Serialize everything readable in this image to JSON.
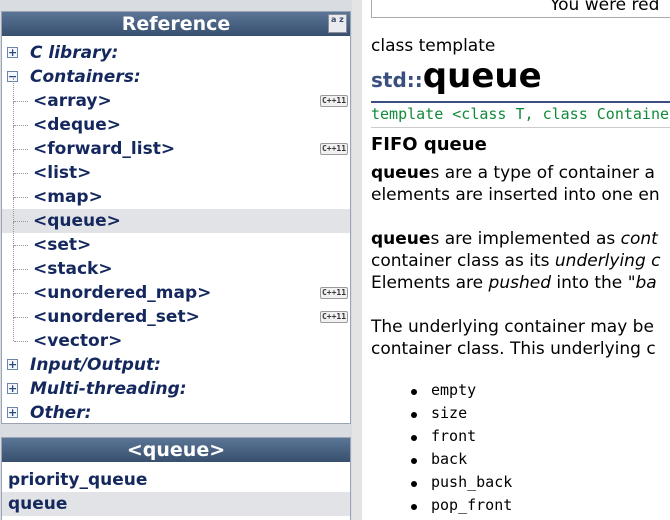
{
  "sidebar": {
    "reference_title": "Reference",
    "sort_icon": "az-sort-icon",
    "sort_text": "a z",
    "cpp11_badge": "C++11",
    "categories": [
      {
        "label": "C library:"
      },
      {
        "label": "Containers:"
      },
      {
        "label": "Input/Output:"
      },
      {
        "label": "Multi-threading:"
      },
      {
        "label": "Other:"
      }
    ],
    "containers": [
      {
        "label": "<array>",
        "cpp11": true
      },
      {
        "label": "<deque>",
        "cpp11": false
      },
      {
        "label": "<forward_list>",
        "cpp11": true
      },
      {
        "label": "<list>",
        "cpp11": false
      },
      {
        "label": "<map>",
        "cpp11": false
      },
      {
        "label": "<queue>",
        "cpp11": false,
        "selected": true
      },
      {
        "label": "<set>",
        "cpp11": false
      },
      {
        "label": "<stack>",
        "cpp11": false
      },
      {
        "label": "<unordered_map>",
        "cpp11": true
      },
      {
        "label": "<unordered_set>",
        "cpp11": true
      },
      {
        "label": "<vector>",
        "cpp11": false
      }
    ],
    "expand_symbol": "+",
    "collapse_symbol": "−"
  },
  "header_panel": {
    "title": "<queue>",
    "items": [
      {
        "label": "priority_queue"
      },
      {
        "label": "queue",
        "selected": true
      }
    ]
  },
  "content": {
    "notice": "You were red",
    "class_template": "class template",
    "namespace": "std::",
    "title": "queue",
    "template_sig": "template <class T, class Containe",
    "fifo_heading": "FIFO queue",
    "p1": {
      "bold": "queue",
      "line1_rest": "s are a type of container a",
      "line2": "elements are inserted into one en"
    },
    "p2": {
      "bold": "queue",
      "line1_rest": "s are implemented as ",
      "line1_ital": "cont",
      "line2_a": "container class as its ",
      "line2_ital": "underlying c",
      "line3_a": "Elements are ",
      "line3_ital": "pushed",
      "line3_b": " into the ",
      "line3_ital2": "\"ba"
    },
    "p3": {
      "line1": "The underlying container may be",
      "line2": "container class. This underlying c"
    },
    "members": [
      "empty",
      "size",
      "front",
      "back",
      "push_back",
      "pop_front"
    ]
  }
}
